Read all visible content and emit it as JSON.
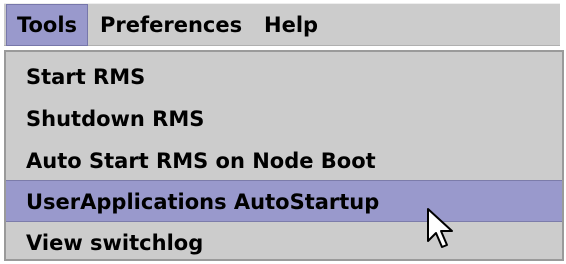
{
  "menubar": {
    "items": [
      {
        "label": "Tools",
        "active": true
      },
      {
        "label": "Preferences",
        "active": false
      },
      {
        "label": "Help",
        "active": false
      }
    ]
  },
  "tools_menu": {
    "items": [
      {
        "label": "Start RMS"
      },
      {
        "label": "Shutdown RMS"
      },
      {
        "label": "Auto Start RMS on Node Boot"
      },
      {
        "label": "UserApplications AutoStartup",
        "highlighted": true
      },
      {
        "label": "View switchlog"
      }
    ]
  },
  "colors": {
    "menu_background": "#cccccc",
    "highlight": "#9999cc",
    "text": "#000000"
  },
  "cursor": {
    "icon": "arrow-pointer-icon"
  }
}
